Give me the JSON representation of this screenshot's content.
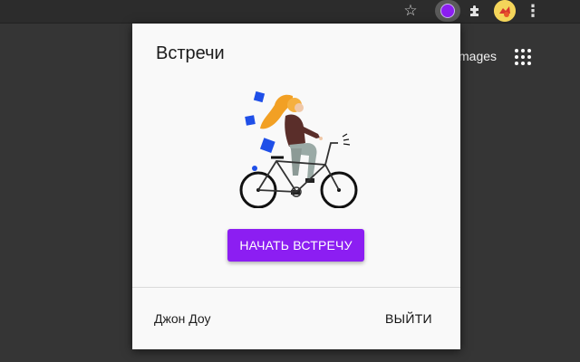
{
  "browser": {
    "toolbar_icons": [
      "star-icon",
      "extension-icon",
      "puzzle-icon",
      "profile-avatar",
      "menu-icon"
    ],
    "star_glyph": "☆",
    "menu_glyph": "⋮",
    "extension_color": "#8c1ef2",
    "avatar_color": "#f4d55a"
  },
  "background_page": {
    "images_link": "mages",
    "apps_icon": "apps-grid-icon"
  },
  "popup": {
    "title": "Встречи",
    "illustration": "woman-on-bicycle",
    "start_button": "НАЧАТЬ ВСТРЕЧУ",
    "user_name": "Джон Доу",
    "logout": "ВЫЙТИ",
    "accent_color": "#8c1ef2"
  }
}
